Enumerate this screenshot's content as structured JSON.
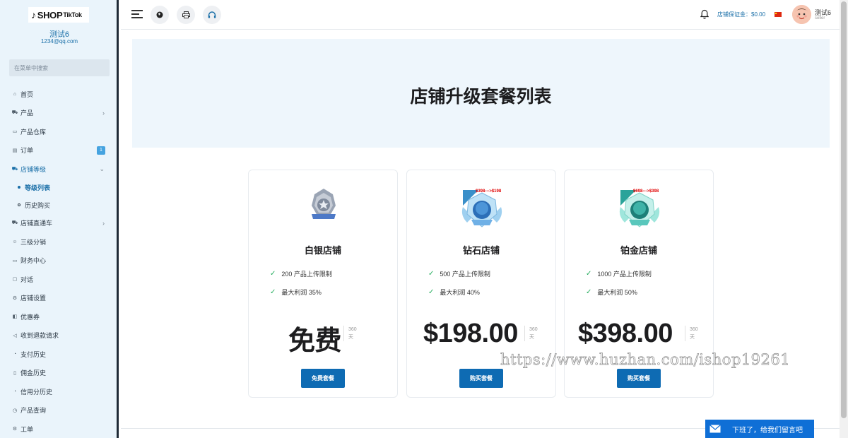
{
  "brand": {
    "logo_text": "SHOP",
    "logo_sub": "TikTok"
  },
  "shop": {
    "name": "测试6",
    "email": "1234@qq.com"
  },
  "search": {
    "placeholder": "在菜单中搜索"
  },
  "sidebar": {
    "items": [
      {
        "label": "首页",
        "icon": "home-icon"
      },
      {
        "label": "产品",
        "icon": "cart-icon",
        "has_arrow": true
      },
      {
        "label": "产品仓库",
        "icon": "warehouse-icon"
      },
      {
        "label": "订单",
        "icon": "order-icon",
        "badge": "1"
      },
      {
        "label": "店铺等级",
        "icon": "shop-level-icon",
        "active": true,
        "expanded": true
      },
      {
        "label": "店铺直通车",
        "icon": "car-icon",
        "has_arrow": true
      },
      {
        "label": "三级分销",
        "icon": "user-icon"
      },
      {
        "label": "财务中心",
        "icon": "finance-icon"
      },
      {
        "label": "对话",
        "icon": "chat-icon"
      },
      {
        "label": "店铺设置",
        "icon": "settings-icon"
      },
      {
        "label": "优惠券",
        "icon": "coupon-icon"
      },
      {
        "label": "收到退款请求",
        "icon": "refund-icon"
      },
      {
        "label": "支付历史",
        "icon": "history-icon"
      },
      {
        "label": "佣金历史",
        "icon": "document-icon"
      },
      {
        "label": "信用分历史",
        "icon": "history-icon"
      },
      {
        "label": "产品查询",
        "icon": "query-icon"
      },
      {
        "label": "工单",
        "icon": "ticket-icon"
      }
    ],
    "submenu": [
      {
        "label": "等级列表",
        "active": true
      },
      {
        "label": "历史购买"
      }
    ]
  },
  "header": {
    "deposit_label": "店铺保证金：$0.00",
    "user_name": "测试6",
    "user_role": "seller",
    "icons": [
      "menu-icon",
      "globe-icon",
      "print-icon",
      "headset-icon",
      "bell-icon",
      "flag-icon"
    ]
  },
  "page": {
    "title": "店铺升级套餐列表"
  },
  "plans": [
    {
      "name": "白银店铺",
      "features": [
        "200 产品上传限制",
        "最大利润 35%"
      ],
      "price": "免费",
      "period_days": "360",
      "period_unit": "天",
      "button": "免费套餐",
      "promo": ""
    },
    {
      "name": "钻石店铺",
      "features": [
        "500 产品上传限制",
        "最大利润 40%"
      ],
      "price": "$198.00",
      "period_days": "360",
      "period_unit": "天",
      "button": "购买套餐",
      "promo": "$398--->$198"
    },
    {
      "name": "铂金店铺",
      "features": [
        "1000 产品上传限制",
        "最大利润 50%"
      ],
      "price": "$398.00",
      "period_days": "360",
      "period_unit": "天",
      "button": "购买套餐",
      "promo": "$698--->$398"
    }
  ],
  "watermark": "https://www.huzhan.com/ishop19261",
  "chat_widget": {
    "label": "下班了，给我们留言吧"
  },
  "colors": {
    "primary": "#0e6bb3",
    "sidebar_bg": "#eaf4fb",
    "hero_bg": "#eef6fc",
    "check": "#27ae60",
    "promo": "#e00000"
  }
}
